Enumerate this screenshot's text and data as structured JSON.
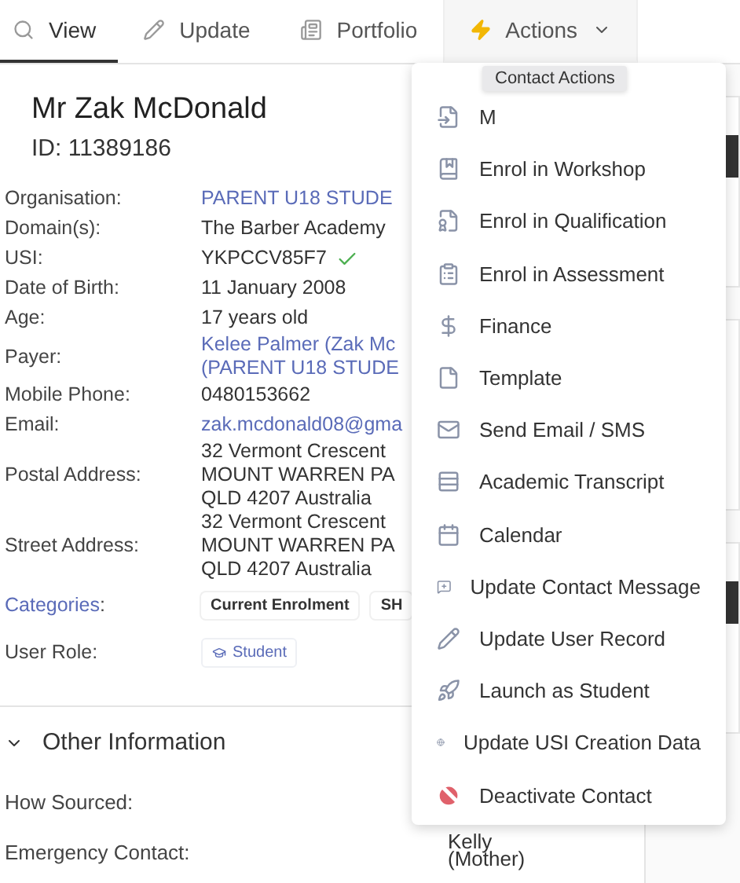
{
  "tabs": [
    {
      "label": "View",
      "selected": true
    },
    {
      "label": "Update",
      "selected": false
    },
    {
      "label": "Portfolio",
      "selected": false
    },
    {
      "label": "Actions",
      "selected": false,
      "expanded": true
    }
  ],
  "contact": {
    "name": "Mr Zak McDonald",
    "id": "ID: 11389186"
  },
  "fields": [
    {
      "label": "Organisation:",
      "lines": [
        "PARENT U18 STUDE"
      ],
      "link": true
    },
    {
      "label": "Domain(s):",
      "lines": [
        "The Barber Academy"
      ],
      "link": false
    },
    {
      "label": "USI:",
      "lines": [
        "YKPCCV85F7"
      ],
      "link": false,
      "verified": true
    },
    {
      "label": "Date of Birth:",
      "lines": [
        "11 January 2008"
      ],
      "link": false
    },
    {
      "label": "Age:",
      "lines": [
        "17 years old"
      ],
      "link": false
    },
    {
      "label": "Payer:",
      "lines": [
        "Kelee Palmer (Zak Mc",
        "(PARENT U18 STUDE"
      ],
      "link": true
    },
    {
      "label": "Mobile Phone:",
      "lines": [
        "0480153662"
      ],
      "link": false
    },
    {
      "label": "Email:",
      "lines": [
        "zak.mcdonald08@gma"
      ],
      "link": true
    },
    {
      "label": "Postal Address:",
      "lines": [
        "32 Vermont Crescent",
        "MOUNT WARREN PA",
        "QLD 4207 Australia"
      ],
      "link": false
    },
    {
      "label": "Street Address:",
      "lines": [
        "32 Vermont Crescent",
        "MOUNT WARREN PA",
        "QLD 4207 Australia"
      ],
      "link": false
    }
  ],
  "categories": {
    "label": "Categories",
    "suffix": ":",
    "tags": [
      "Current Enrolment",
      "SH"
    ]
  },
  "user_role": {
    "label": "User Role:",
    "role": "Student"
  },
  "other_information": {
    "title": "Other Information",
    "expanded": true,
    "fields": [
      {
        "label": "How Sourced:"
      },
      {
        "label": "Emergency Contact:"
      }
    ],
    "emergency_contact": [
      "Kelly",
      "(Mother)"
    ]
  },
  "menu": {
    "tooltip": "Contact Actions",
    "items": [
      {
        "label": "M"
      },
      {
        "label": "Enrol in Workshop"
      },
      {
        "label": "Enrol in Qualification"
      },
      {
        "label": "Enrol in Assessment"
      },
      {
        "label": "Finance"
      },
      {
        "label": "Template"
      },
      {
        "label": "Send Email / SMS"
      },
      {
        "label": "Academic Transcript"
      },
      {
        "label": "Calendar"
      },
      {
        "label": "Update Contact Message"
      },
      {
        "label": "Update User Record"
      },
      {
        "label": "Launch as Student"
      },
      {
        "label": "Update USI Creation Data"
      },
      {
        "label": "Deactivate Contact",
        "kind": "danger"
      }
    ]
  }
}
